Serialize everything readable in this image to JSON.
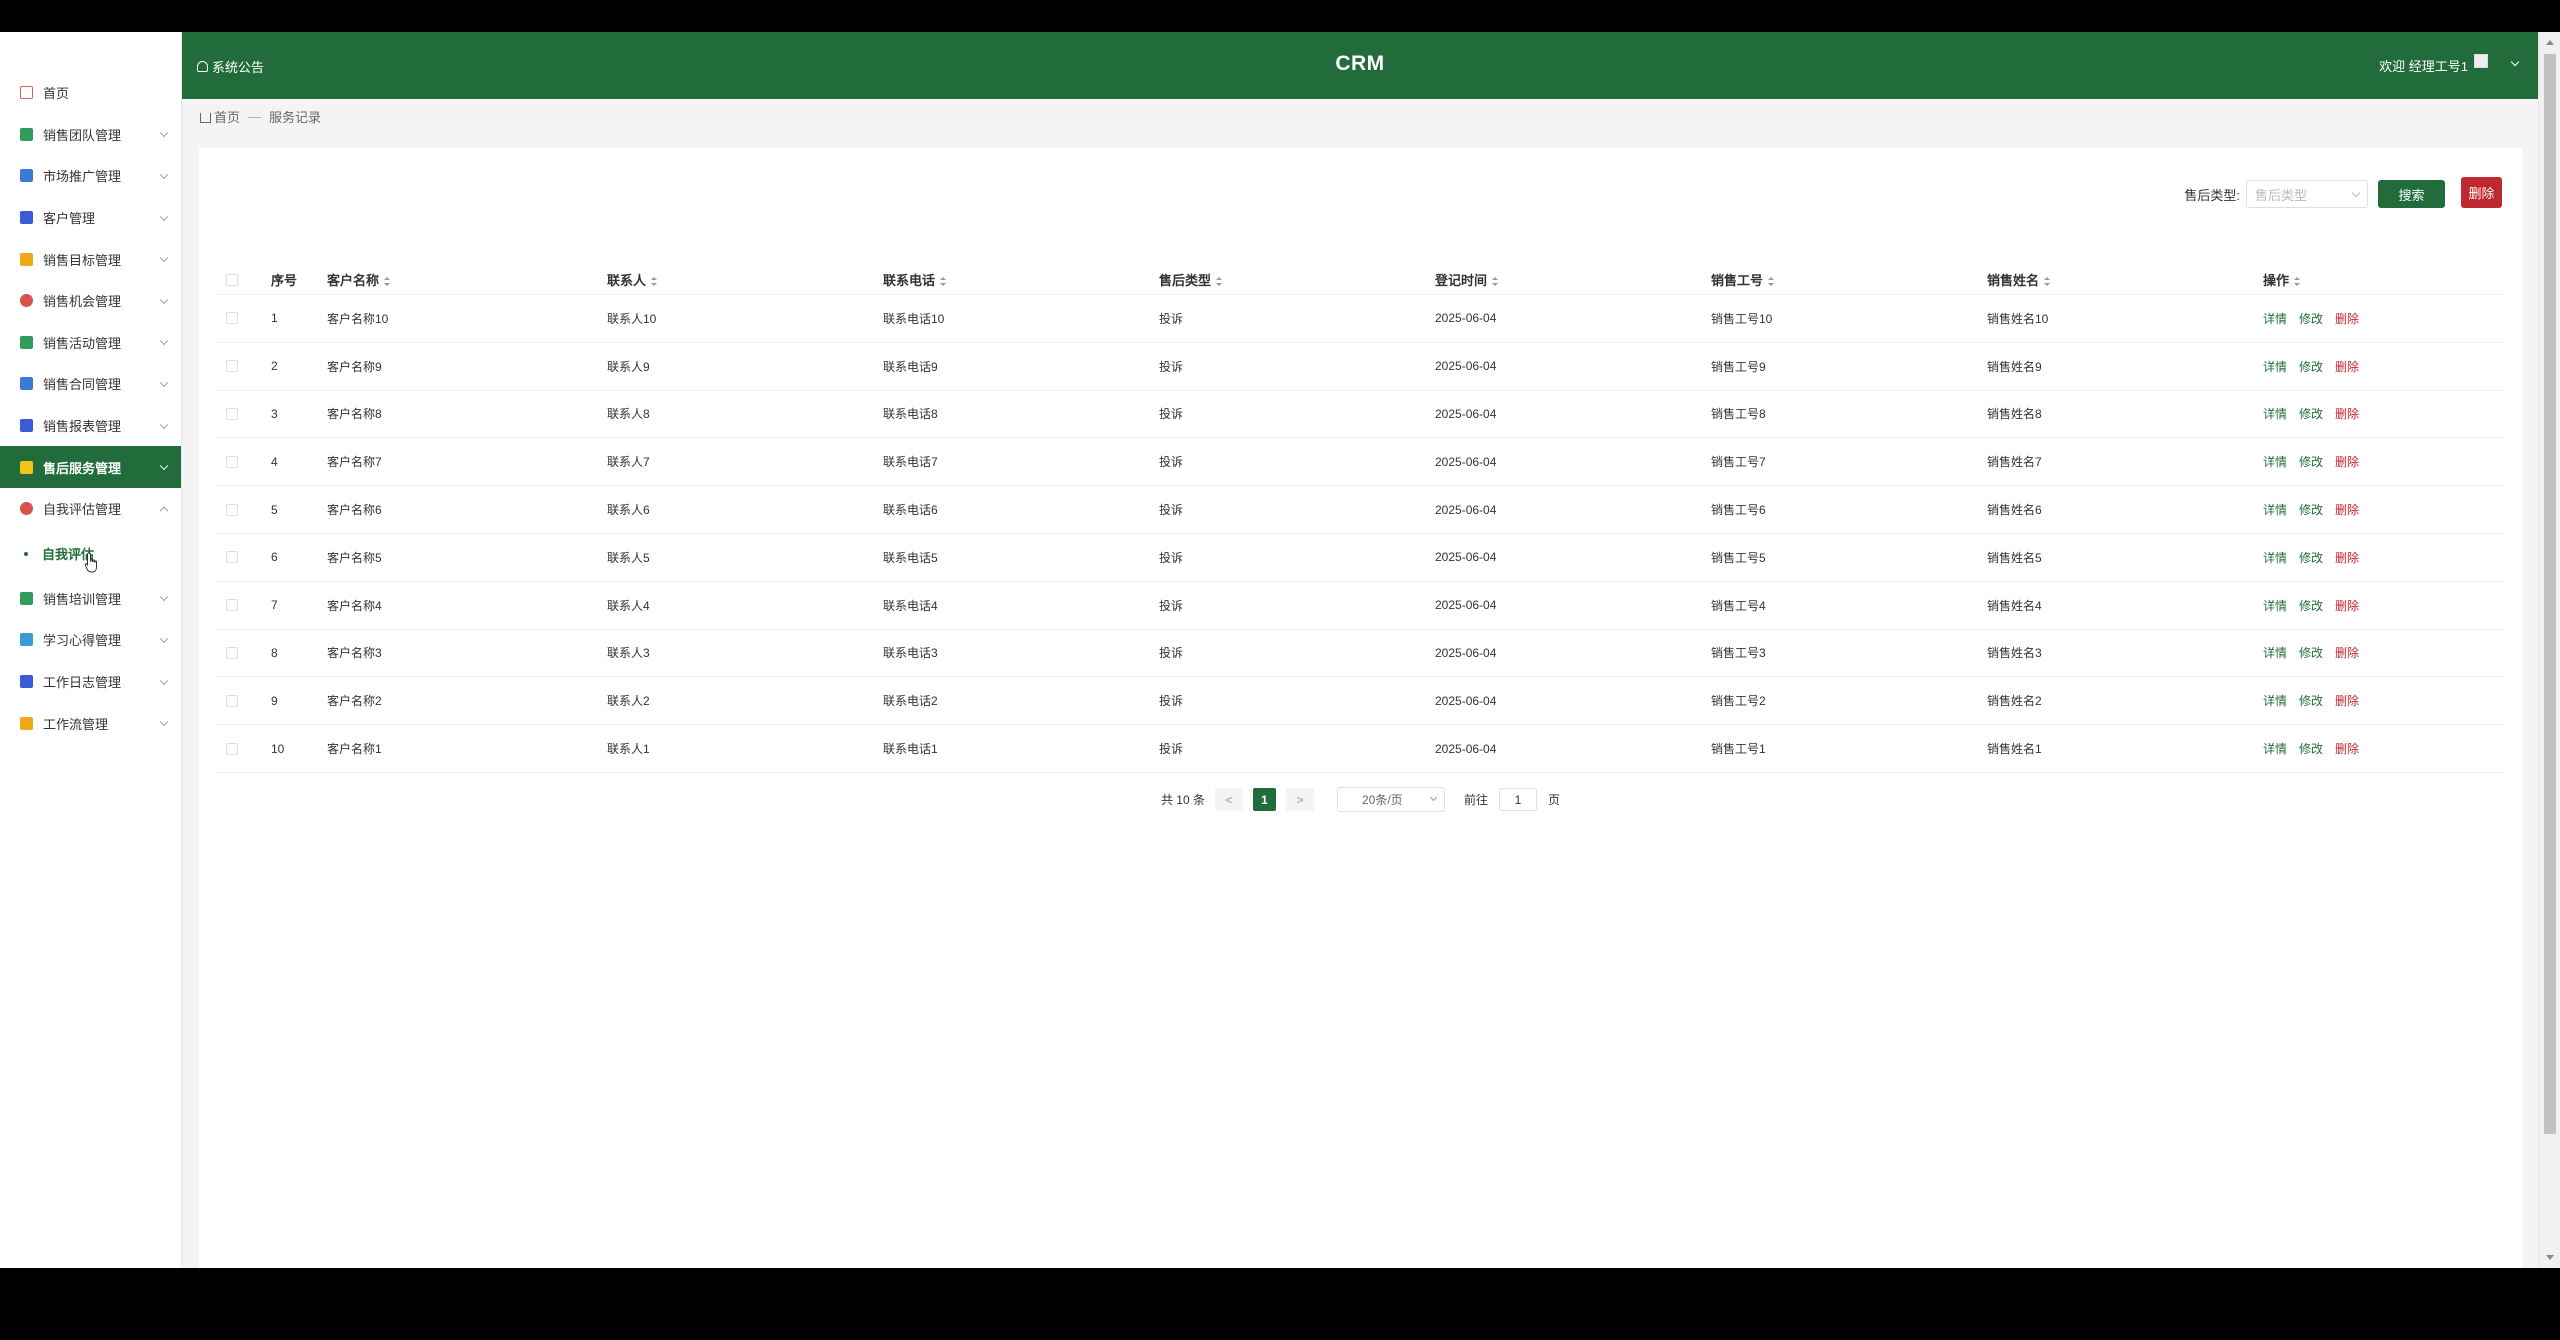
{
  "header": {
    "notice": "系统公告",
    "title": "CRM",
    "user": "欢迎 经理工号1"
  },
  "sidebar": {
    "items": [
      {
        "label": "首页",
        "icon": "home-icon",
        "color": "#e45b5b"
      },
      {
        "label": "销售团队管理",
        "icon": "team-icon",
        "color": "#2e9d5a"
      },
      {
        "label": "市场推广管理",
        "icon": "promotion-icon",
        "color": "#3a7bd5"
      },
      {
        "label": "客户管理",
        "icon": "customer-icon",
        "color": "#3a5bd5"
      },
      {
        "label": "销售目标管理",
        "icon": "target-icon",
        "color": "#f0a81a"
      },
      {
        "label": "销售机会管理",
        "icon": "opportunity-icon",
        "color": "#d9534f"
      },
      {
        "label": "销售活动管理",
        "icon": "activity-icon",
        "color": "#2e9d5a"
      },
      {
        "label": "销售合同管理",
        "icon": "contract-icon",
        "color": "#3a7bd5"
      },
      {
        "label": "销售报表管理",
        "icon": "report-icon",
        "color": "#3a5bd5"
      },
      {
        "label": "售后服务管理",
        "icon": "service-icon",
        "color": "#f0c419"
      },
      {
        "label": "自我评估管理",
        "icon": "evaluation-icon",
        "color": "#d9534f"
      },
      {
        "label": "销售培训管理",
        "icon": "training-icon",
        "color": "#2e9d5a"
      },
      {
        "label": "学习心得管理",
        "icon": "learning-icon",
        "color": "#3a9bd5"
      },
      {
        "label": "工作日志管理",
        "icon": "log-icon",
        "color": "#3a5bd5"
      },
      {
        "label": "工作流管理",
        "icon": "workflow-icon",
        "color": "#f0a81a"
      }
    ],
    "submenu": {
      "label": "自我评估"
    }
  },
  "breadcrumb": {
    "home": "首页",
    "sep": "—",
    "current": "服务记录"
  },
  "toolbar": {
    "type_label": "售后类型:",
    "type_placeholder": "售后类型",
    "search": "搜索",
    "delete": "删除"
  },
  "table": {
    "headers": [
      "序号",
      "客户名称",
      "联系人",
      "联系电话",
      "售后类型",
      "登记时间",
      "销售工号",
      "销售姓名",
      "操作"
    ],
    "rows": [
      [
        "1",
        "客户名称10",
        "联系人10",
        "联系电话10",
        "投诉",
        "2025-06-04",
        "销售工号10",
        "销售姓名10"
      ],
      [
        "2",
        "客户名称9",
        "联系人9",
        "联系电话9",
        "投诉",
        "2025-06-04",
        "销售工号9",
        "销售姓名9"
      ],
      [
        "3",
        "客户名称8",
        "联系人8",
        "联系电话8",
        "投诉",
        "2025-06-04",
        "销售工号8",
        "销售姓名8"
      ],
      [
        "4",
        "客户名称7",
        "联系人7",
        "联系电话7",
        "投诉",
        "2025-06-04",
        "销售工号7",
        "销售姓名7"
      ],
      [
        "5",
        "客户名称6",
        "联系人6",
        "联系电话6",
        "投诉",
        "2025-06-04",
        "销售工号6",
        "销售姓名6"
      ],
      [
        "6",
        "客户名称5",
        "联系人5",
        "联系电话5",
        "投诉",
        "2025-06-04",
        "销售工号5",
        "销售姓名5"
      ],
      [
        "7",
        "客户名称4",
        "联系人4",
        "联系电话4",
        "投诉",
        "2025-06-04",
        "销售工号4",
        "销售姓名4"
      ],
      [
        "8",
        "客户名称3",
        "联系人3",
        "联系电话3",
        "投诉",
        "2025-06-04",
        "销售工号3",
        "销售姓名3"
      ],
      [
        "9",
        "客户名称2",
        "联系人2",
        "联系电话2",
        "投诉",
        "2025-06-04",
        "销售工号2",
        "销售姓名2"
      ],
      [
        "10",
        "客户名称1",
        "联系人1",
        "联系电话1",
        "投诉",
        "2025-06-04",
        "销售工号1",
        "销售姓名1"
      ]
    ],
    "actions": [
      "详情",
      "修改",
      "删除"
    ]
  },
  "pagination": {
    "total": "共 10 条",
    "prev": "<",
    "current": "1",
    "next": ">",
    "page_size": "20条/页",
    "goto": "前往",
    "goto_value": "1",
    "page_unit": "页"
  },
  "colors": {
    "primary": "#226c3b",
    "danger": "#c0282f"
  }
}
